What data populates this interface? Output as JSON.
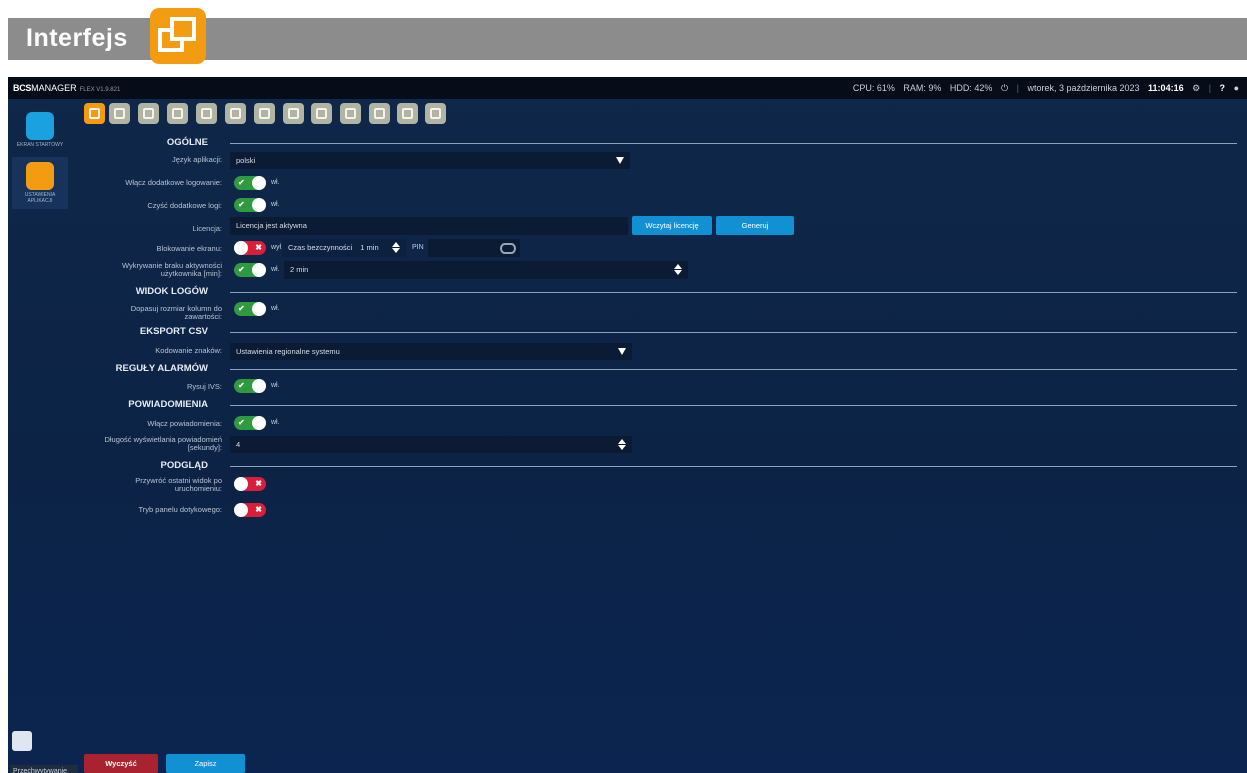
{
  "banner": {
    "title": "Interfejs",
    "icon": "window-icon"
  },
  "topbar": {
    "brand_bold": "BCS",
    "brand_rest": "MANAGER",
    "version": "FLEX V1.9.821",
    "cpu": "CPU: 61%",
    "ram": "RAM: 9%",
    "hdd": "HDD: 42%",
    "date": "wtorek, 3 października 2023",
    "time": "11:04:16",
    "help": "?",
    "user_icon": "user-icon"
  },
  "sidebar": {
    "items": [
      {
        "label": "EKRAN STARTOWY",
        "icon": "home-icon",
        "color": "#1aa1e0"
      },
      {
        "label": "USTAWIENIA APLIKACJI",
        "icon": "gears-icon",
        "color": "#f39c12"
      }
    ],
    "footer": "Przechwytywanie"
  },
  "toolbar": {
    "icons": [
      "interface-icon",
      "film-icon",
      "camera-icon",
      "chart-icon",
      "display-icon",
      "cloud-sync-icon",
      "car-icon",
      "tools-icon",
      "calendar-icon",
      "mail-icon",
      "network-icon",
      "package-icon",
      "cloud-icon"
    ]
  },
  "sections": {
    "general": "OGÓLNE",
    "logs": "WIDOK LOGÓW",
    "csv": "EKSPORT CSV",
    "alarms": "REGUŁY ALARMÓW",
    "notifications": "POWIADOMIENIA",
    "preview": "PODGLĄD"
  },
  "fields": {
    "language_label": "Język aplikacji:",
    "language_value": "polski",
    "extra_logging_label": "Włącz dodatkowe logowanie:",
    "extra_logging_state": "wł.",
    "clean_logs_label": "Czyść dodatkowe logi:",
    "clean_logs_state": "wł.",
    "license_label": "Licencja:",
    "license_value": "Licencja jest aktywna",
    "load_license_btn": "Wczytaj licencję",
    "generate_btn": "Generuj",
    "screen_lock_label": "Blokowanie ekranu:",
    "screen_lock_state": "wył.",
    "idle_time_label": "Czas bezczynności",
    "idle_time_value": "1 min",
    "pin_label": "PIN",
    "inactivity_label_1": "Wykrywanie braku aktywności",
    "inactivity_label_2": "użytkownika [min]:",
    "inactivity_state": "wł.",
    "inactivity_value": "2 min",
    "fit_columns_label_1": "Dopasuj rozmiar kolumn do",
    "fit_columns_label_2": "zawartości:",
    "fit_columns_state": "wł.",
    "encoding_label": "Kodowanie znaków:",
    "encoding_value": "Ustawienia regionalne systemu",
    "draw_ivs_label": "Rysuj IVS:",
    "draw_ivs_state": "wł.",
    "enable_notifications_label": "Włącz powiadomienia:",
    "enable_notifications_state": "wł.",
    "notif_duration_label_1": "Długość wyświetlania powiadomień",
    "notif_duration_label_2": "[sekundy]:",
    "notif_duration_value": "4",
    "restore_view_label_1": "Przywróć ostatni widok po",
    "restore_view_label_2": "uruchomieniu:",
    "touch_panel_label": "Tryb panelu dotykowego:"
  },
  "footer_buttons": {
    "clear": "Wyczyść",
    "save": "Zapisz"
  },
  "colors": {
    "accent_orange": "#f39c12",
    "toggle_on": "#2e9c3e",
    "toggle_off": "#d81e3a",
    "button_blue": "#1190d4",
    "button_red": "#a8232f"
  }
}
